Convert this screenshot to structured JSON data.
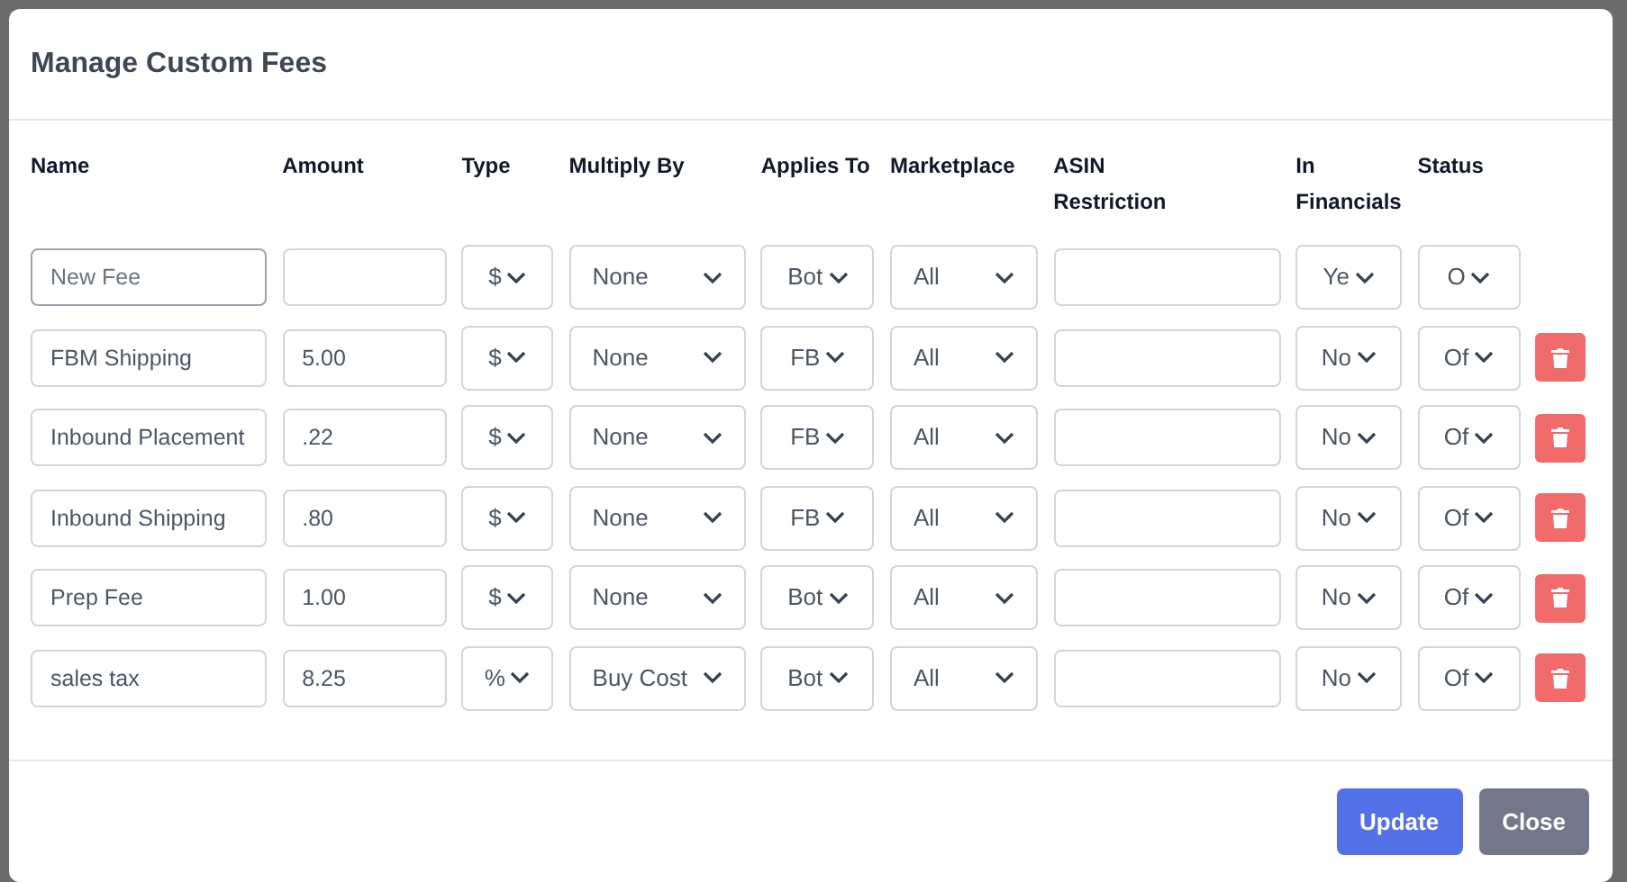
{
  "dialog": {
    "title": "Manage Custom Fees"
  },
  "columns": [
    "Name",
    "Amount",
    "Type",
    "Multiply By",
    "Applies To",
    "Marketplace",
    "ASIN Restriction",
    "In Financials",
    "Status"
  ],
  "rows": [
    {
      "name_placeholder": "New Fee",
      "focused": true,
      "type": "$",
      "multiply_by": "None",
      "applies_to": "Bot",
      "marketplace": "All",
      "in_financials": "Ye",
      "status": "O",
      "deletable": false
    },
    {
      "name": "FBM Shipping",
      "focused": false,
      "amount": "5.00",
      "type": "$",
      "multiply_by": "None",
      "applies_to": "FB",
      "marketplace": "All",
      "in_financials": "No",
      "status": "Of",
      "deletable": true
    },
    {
      "name": "Inbound Placement",
      "focused": false,
      "amount": ".22",
      "type": "$",
      "multiply_by": "None",
      "applies_to": "FB",
      "marketplace": "All",
      "in_financials": "No",
      "status": "Of",
      "deletable": true
    },
    {
      "name": "Inbound Shipping",
      "focused": false,
      "amount": ".80",
      "type": "$",
      "multiply_by": "None",
      "applies_to": "FB",
      "marketplace": "All",
      "in_financials": "No",
      "status": "Of",
      "deletable": true
    },
    {
      "name": "Prep Fee",
      "focused": false,
      "amount": "1.00",
      "type": "$",
      "multiply_by": "None",
      "applies_to": "Bot",
      "marketplace": "All",
      "in_financials": "No",
      "status": "Of",
      "deletable": true
    },
    {
      "name": "sales tax",
      "focused": false,
      "amount": "8.25",
      "type": "%",
      "multiply_by": "Buy Cost",
      "applies_to": "Bot",
      "marketplace": "All",
      "in_financials": "No",
      "status": "Of",
      "deletable": true
    }
  ],
  "buttons": [
    {
      "label": "Update",
      "kind": "primary"
    },
    {
      "label": "Close",
      "kind": "secondary"
    }
  ]
}
